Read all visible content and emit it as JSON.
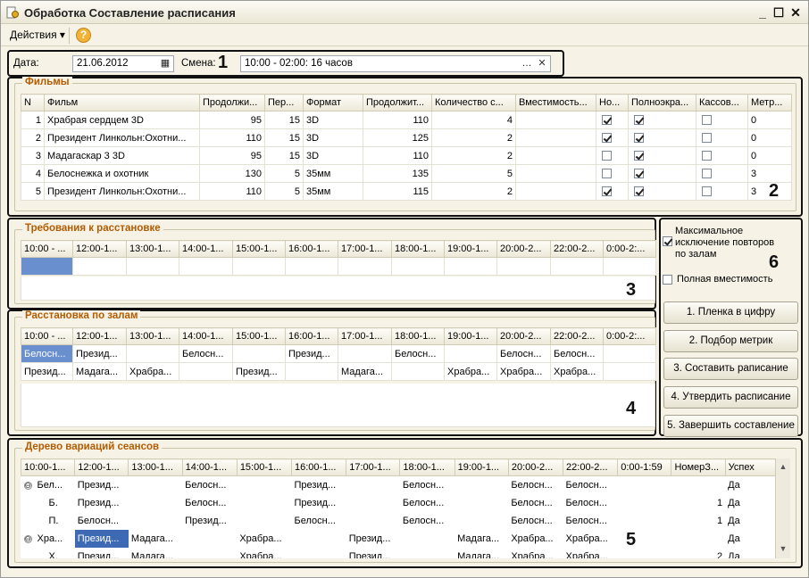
{
  "window": {
    "title": "Обработка  Составление расписания"
  },
  "toolbar": {
    "actions_label": "Действия",
    "help_label": "?"
  },
  "header": {
    "date_label": "Дата:",
    "date_value": "21.06.2012",
    "shift_label": "Смена:",
    "shift_value": "10:00 - 02:00: 16 часов"
  },
  "markers": [
    "1",
    "2",
    "3",
    "4",
    "5",
    "6"
  ],
  "films": {
    "title": "Фильмы",
    "columns": [
      "N",
      "Фильм",
      "Продолжи...",
      "Пер...",
      "Формат",
      "Продолжит...",
      "Количество с...",
      "Вместимость...",
      "Но...",
      "Полноэкра...",
      "Кассов...",
      "Метр..."
    ],
    "rows": [
      {
        "n": "1",
        "film": "Храбрая сердцем 3D",
        "dur": "95",
        "per": "15",
        "format": "3D",
        "dur2": "110",
        "count": "4",
        "cap": "",
        "new": true,
        "full": true,
        "box": false,
        "metric": "0"
      },
      {
        "n": "2",
        "film": "Президент Линкольн:Охотни...",
        "dur": "110",
        "per": "15",
        "format": "3D",
        "dur2": "125",
        "count": "2",
        "cap": "",
        "new": true,
        "full": true,
        "box": false,
        "metric": "0"
      },
      {
        "n": "3",
        "film": "Мадагаскар 3 3D",
        "dur": "95",
        "per": "15",
        "format": "3D",
        "dur2": "110",
        "count": "2",
        "cap": "",
        "new": false,
        "full": true,
        "box": false,
        "metric": "0"
      },
      {
        "n": "4",
        "film": "Белоснежка и охотник",
        "dur": "130",
        "per": "5",
        "format": "35мм",
        "dur2": "135",
        "count": "5",
        "cap": "",
        "new": false,
        "full": true,
        "box": false,
        "metric": "3"
      },
      {
        "n": "5",
        "film": "Президент Линкольн:Охотни...",
        "dur": "110",
        "per": "5",
        "format": "35мм",
        "dur2": "115",
        "count": "2",
        "cap": "",
        "new": true,
        "full": true,
        "box": false,
        "metric": "3"
      }
    ]
  },
  "requirements": {
    "title": "Требования к расстановке",
    "columns": [
      "10:00 - ...",
      "12:00-1...",
      "13:00-1...",
      "14:00-1...",
      "15:00-1...",
      "16:00-1...",
      "17:00-1...",
      "18:00-1...",
      "19:00-1...",
      "20:00-2...",
      "22:00-2...",
      "0:00-2:..."
    ]
  },
  "placement": {
    "title": "Расстановка по залам",
    "columns": [
      "10:00 - ...",
      "12:00-1...",
      "13:00-1...",
      "14:00-1...",
      "15:00-1...",
      "16:00-1...",
      "17:00-1...",
      "18:00-1...",
      "19:00-1...",
      "20:00-2...",
      "22:00-2...",
      "0:00-2:..."
    ],
    "rows": [
      [
        "Белосн...",
        "Презид...",
        "",
        "Белосн...",
        "",
        "Презид...",
        "",
        "Белосн...",
        "",
        "Белосн...",
        "Белосн...",
        ""
      ],
      [
        "Презид...",
        "Мадага...",
        "Храбра...",
        "",
        "Презид...",
        "",
        "Мадага...",
        "",
        "Храбра...",
        "Храбра...",
        "Храбра...",
        ""
      ]
    ]
  },
  "options": {
    "max_exclusion_label": "Максимальное исключение повторов по залам",
    "max_exclusion_checked": true,
    "full_capacity_label": "Полная вместимость",
    "full_capacity_checked": false
  },
  "buttons": [
    "1. Пленка в цифру",
    "2. Подбор метрик",
    "3. Составить раписание",
    "4. Утвердить расписание",
    "5. Завершить составление"
  ],
  "tree": {
    "title": "Дерево вариаций сеансов",
    "columns": [
      "10:00-1...",
      "12:00-1...",
      "13:00-1...",
      "14:00-1...",
      "15:00-1...",
      "16:00-1...",
      "17:00-1...",
      "18:00-1...",
      "19:00-1...",
      "20:00-2...",
      "22:00-2...",
      "0:00-1:59",
      "НомерЗ...",
      "Успех"
    ],
    "rows": [
      {
        "toggle": "⊖",
        "indent": 0,
        "cells": [
          "Бел...",
          "Презид...",
          "",
          "Белосн...",
          "",
          "Презид...",
          "",
          "Белосн...",
          "",
          "Белосн...",
          "Белосн...",
          "",
          "",
          "Да"
        ]
      },
      {
        "toggle": "",
        "indent": 1,
        "cells": [
          "Б.",
          "Презид...",
          "",
          "Белосн...",
          "",
          "Презид...",
          "",
          "Белосн...",
          "",
          "Белосн...",
          "Белосн...",
          "",
          "1",
          "Да"
        ]
      },
      {
        "toggle": "",
        "indent": 1,
        "cells": [
          "П.",
          "Белосн...",
          "",
          "Презид...",
          "",
          "Белосн...",
          "",
          "Белосн...",
          "",
          "Белосн...",
          "Белосн...",
          "",
          "1",
          "Да"
        ]
      },
      {
        "toggle": "⊖",
        "indent": 0,
        "cells": [
          "Хра...",
          "Презид...",
          "Мадага...",
          "",
          "Храбра...",
          "",
          "Презид...",
          "",
          "Мадага...",
          "Храбра...",
          "Храбра...",
          "",
          "",
          "Да"
        ]
      },
      {
        "toggle": "",
        "indent": 1,
        "cells": [
          "Х.",
          "Презид...",
          "Мадага...",
          "",
          "Храбра...",
          "",
          "Презид...",
          "",
          "Мадага...",
          "Храбра...",
          "Храбра...",
          "",
          "2",
          "Да"
        ]
      }
    ]
  }
}
